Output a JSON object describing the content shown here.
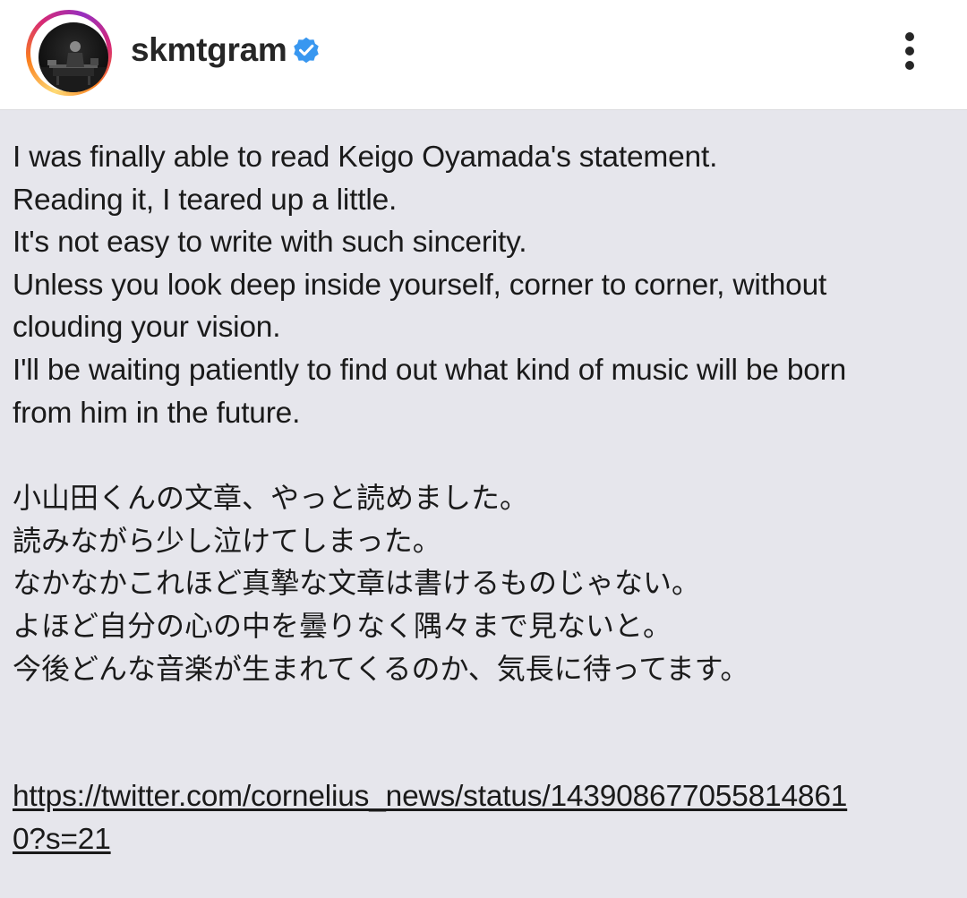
{
  "header": {
    "username": "skmtgram",
    "verified": true,
    "avatar_icon": "profile-photo-pianist-on-stage",
    "more_icon": "more-vertical-icon",
    "verified_color": "#3897f0"
  },
  "post": {
    "english_lines": [
      "I was finally able to read Keigo Oyamada's statement.",
      "Reading it, I teared up a little.",
      "It's not easy to write with such sincerity.",
      "Unless you look deep inside yourself, corner to corner, without",
      "clouding your vision.",
      "I'll be waiting patiently to find out what kind of music will be born",
      "from him in the future."
    ],
    "japanese_lines": [
      "小山田くんの文章、やっと読めました。",
      "読みながら少し泣けてしまった。",
      "なかなかこれほど真摯な文章は書けるものじゃない。",
      "よほど自分の心の中を曇りなく隅々まで見ないと。",
      "今後どんな音楽が生まれてくるのか、気長に待ってます。"
    ],
    "link_lines": [
      "https://twitter.com/cornelius_news/status/143908677055814861",
      "0?s=21"
    ]
  }
}
